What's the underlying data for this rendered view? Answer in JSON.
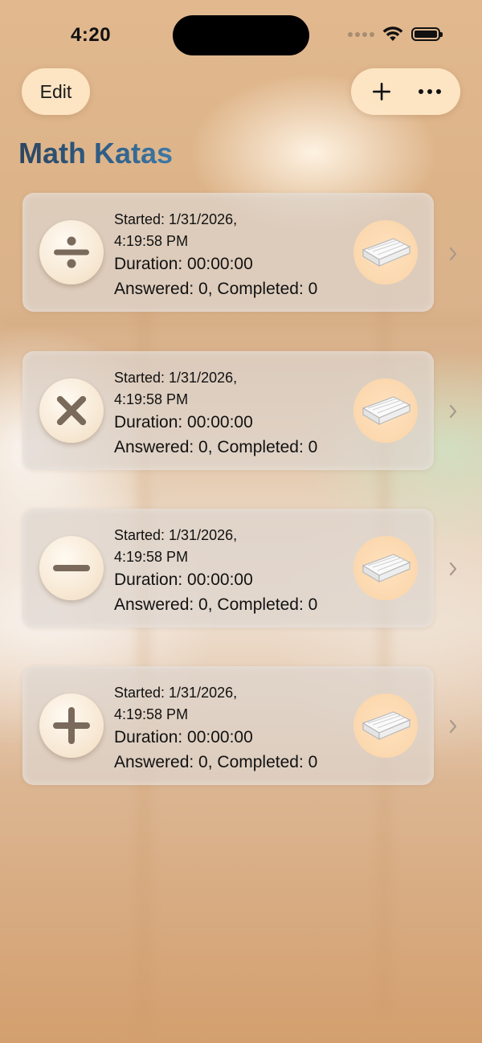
{
  "status_bar": {
    "time": "4:20"
  },
  "nav": {
    "edit_label": "Edit",
    "add_icon": "plus-icon",
    "more_icon": "ellipsis-icon"
  },
  "title": "Math Katas",
  "colors": {
    "title_gradient_start": "#2d4660",
    "title_gradient_end": "#3f79a8",
    "pill_background": "#ffe8c8",
    "card_background": "#ded6ce"
  },
  "sessions": [
    {
      "operation": "division",
      "icon": "division-icon",
      "started_line1": "Started: 1/31/2026,",
      "started_line2": "4:19:58 PM",
      "duration": "Duration: 00:00:00",
      "stats": "Answered: 0, Completed: 0",
      "belt_icon": "white-belt-icon"
    },
    {
      "operation": "multiplication",
      "icon": "multiplication-icon",
      "started_line1": "Started: 1/31/2026,",
      "started_line2": "4:19:58 PM",
      "duration": "Duration: 00:00:00",
      "stats": "Answered: 0, Completed: 0",
      "belt_icon": "white-belt-icon"
    },
    {
      "operation": "subtraction",
      "icon": "minus-icon",
      "started_line1": "Started: 1/31/2026,",
      "started_line2": "4:19:58 PM",
      "duration": "Duration: 00:00:00",
      "stats": "Answered: 0, Completed: 0",
      "belt_icon": "white-belt-icon"
    },
    {
      "operation": "addition",
      "icon": "plus-icon",
      "started_line1": "Started: 1/31/2026,",
      "started_line2": "4:19:58 PM",
      "duration": "Duration: 00:00:00",
      "stats": "Answered: 0, Completed: 0",
      "belt_icon": "white-belt-icon"
    }
  ]
}
